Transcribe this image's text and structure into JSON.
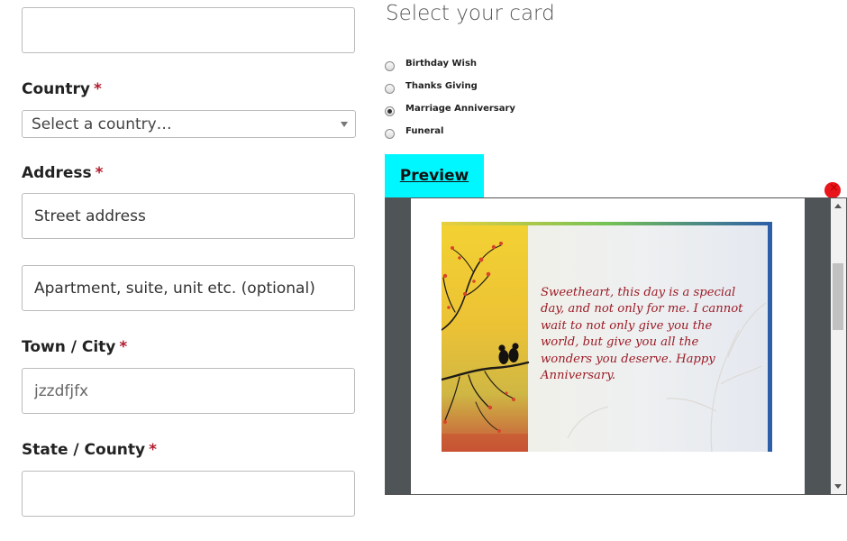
{
  "left_form": {
    "country": {
      "label": "Country",
      "required": "*",
      "select_value": "Select a country…"
    },
    "address": {
      "label": "Address",
      "required": "*",
      "street_placeholder": "Street address",
      "apartment_placeholder": "Apartment, suite, unit etc. (optional)"
    },
    "town": {
      "label": "Town / City",
      "required": "*",
      "value": "jzzdfjfx"
    },
    "state": {
      "label": "State / County",
      "required": "*"
    }
  },
  "right_panel": {
    "title": "Select your card",
    "options": [
      "Birthday Wish",
      "Thanks Giving",
      "Marriage Anniversary",
      "Funeral"
    ],
    "selected_option": "Marriage Anniversary",
    "preview_button": "Preview",
    "card_message": "Sweetheart, this day is a special day, and not only for me. I cannot wait to not only give you the world, but give you all the wonders you deserve. Happy Anniversary."
  },
  "colors": {
    "preview_button_bg": "#00f7ff",
    "required_marker": "#b01c2e",
    "card_text": "#9c1c27",
    "close_dot": "#e8151b"
  },
  "icons": [
    "chevron-down-icon",
    "close-icon",
    "birds-on-branch-illustration"
  ]
}
